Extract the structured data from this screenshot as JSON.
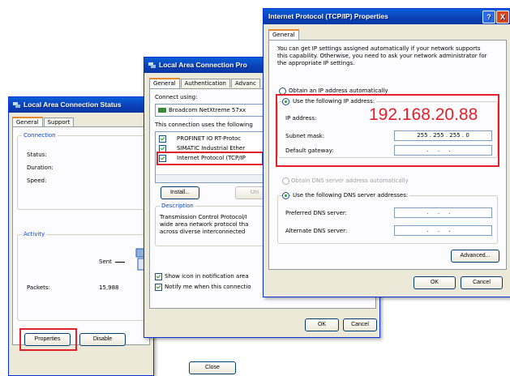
{
  "status_window": {
    "title": "Local Area Connection Status",
    "tabs": [
      "General",
      "Support"
    ],
    "connection_group": "Connection",
    "rows": [
      {
        "label": "Status:"
      },
      {
        "label": "Duration:"
      },
      {
        "label": "Speed:"
      }
    ],
    "activity_group": "Activity",
    "sent_label": "Sent",
    "packets_label": "Packets:",
    "packets_sent": "15,988",
    "properties_button": "Properties",
    "disable_button": "Disable",
    "close_button": "Close"
  },
  "properties_window": {
    "title": "Local Area Connection Pro",
    "tabs": [
      "General",
      "Authentication",
      "Advanc"
    ],
    "connect_using_label": "Connect using:",
    "adapter": "Broadcom NetXtreme 57xx",
    "uses_label": "This connection uses the following",
    "items": [
      {
        "label": "PROFINET IO RT-Protoc",
        "checked": true
      },
      {
        "label": "SIMATIC Industrial Ether",
        "checked": true
      },
      {
        "label": "Internet Protocol (TCP/IP",
        "checked": true
      }
    ],
    "install_button": "Install...",
    "uninstall_button": "Uni",
    "description_group": "Description",
    "description_text": [
      "Transmission Control Protocol/I",
      "wide area network protocol tha",
      "across diverse interconnected"
    ],
    "show_icon_label": "Show icon in notification area",
    "notify_label": "Notify me when this connectio",
    "ok_button": "OK",
    "cancel_button": "Cancel"
  },
  "tcpip_window": {
    "title": "Internet Protocol (TCP/IP) Properties",
    "tab": "General",
    "intro": [
      "You can get IP settings assigned automatically if your network supports",
      "this capability. Otherwise, you need to ask your network administrator for",
      "the appropriate IP settings."
    ],
    "auto_ip_label": "Obtain an IP address automatically",
    "use_ip_label": "Use the following IP address:",
    "ip_label": "IP address:",
    "ip_value": "192.168.20.88",
    "subnet_label": "Subnet mask:",
    "subnet_value": "255 . 255 . 255 . 0",
    "gateway_label": "Default gateway:",
    "auto_dns_label": "Obtain DNS server address automatically",
    "use_dns_label": "Use the following DNS server addresses:",
    "preferred_dns_label": "Preferred DNS server:",
    "alternate_dns_label": "Alternate DNS server:",
    "advanced_button": "Advanced...",
    "ok_button": "OK",
    "cancel_button": "Cancel",
    "help_button": "?",
    "close_button": "X"
  },
  "colors": {
    "highlight": "#e4202a",
    "title_blue": "#0a5fd8",
    "ip_text": "#e4202a"
  }
}
